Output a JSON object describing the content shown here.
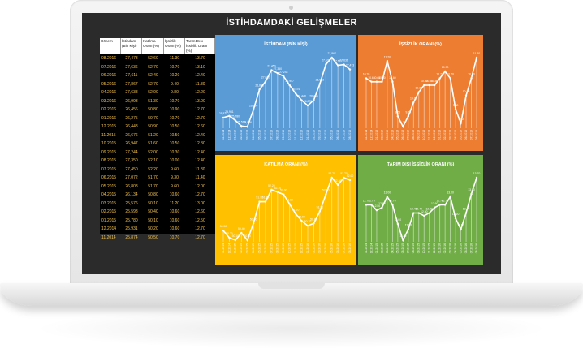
{
  "dashboard": {
    "title": "İSTİHDAMDAKİ GELİŞMELER",
    "table": {
      "headers": [
        "Dönem",
        "İstihdam (Bin Kişi)",
        "Katılma Oranı (%)",
        "İşsizlik Oranı (%)",
        "Tarım Dışı İşsizlik Oranı (%)"
      ],
      "rows": [
        [
          "08.2016",
          "27,473",
          "52.60",
          "11.30",
          "13.70"
        ],
        [
          "07.2016",
          "27,636",
          "52.70",
          "10.70",
          "13.10"
        ],
        [
          "06.2016",
          "27,611",
          "52.40",
          "10.20",
          "12.40"
        ],
        [
          "05.2016",
          "27,867",
          "52.70",
          "9.40",
          "11.80"
        ],
        [
          "04.2016",
          "27,638",
          "52.00",
          "9.80",
          "12.20"
        ],
        [
          "03.2016",
          "26,993",
          "51.30",
          "10.70",
          "13.00"
        ],
        [
          "02.2016",
          "26,456",
          "50.80",
          "10.90",
          "12.70"
        ],
        [
          "01.2016",
          "26,275",
          "50.70",
          "10.70",
          "12.70"
        ],
        [
          "12.2015",
          "26,448",
          "50.90",
          "10.50",
          "12.60"
        ],
        [
          "11.2015",
          "26,676",
          "51.20",
          "10.50",
          "12.40"
        ],
        [
          "10.2015",
          "26,947",
          "51.60",
          "10.50",
          "12.30"
        ],
        [
          "09.2015",
          "27,244",
          "52.00",
          "10.30",
          "12.40"
        ],
        [
          "08.2015",
          "27,350",
          "52.10",
          "10.00",
          "12.40"
        ],
        [
          "07.2015",
          "27,450",
          "52.20",
          "9.60",
          "11.80"
        ],
        [
          "06.2015",
          "27,072",
          "51.70",
          "9.30",
          "11.40"
        ],
        [
          "05.2015",
          "26,808",
          "51.70",
          "9.60",
          "12.00"
        ],
        [
          "04.2015",
          "26,134",
          "50.80",
          "10.60",
          "12.70"
        ],
        [
          "03.2015",
          "25,576",
          "50.10",
          "11.20",
          "13.00"
        ],
        [
          "02.2015",
          "25,593",
          "50.40",
          "10.60",
          "12.60"
        ],
        [
          "01.2015",
          "25,780",
          "50.10",
          "10.60",
          "12.50"
        ],
        [
          "12.2014",
          "25,931",
          "50.20",
          "10.60",
          "12.70"
        ],
        [
          "11.2014",
          "25,874",
          "50.50",
          "10.70",
          "12.70"
        ]
      ]
    }
  },
  "chart_data": [
    {
      "type": "line",
      "title": "İSTİHDAM (BİN KİŞİ)",
      "color": "#4a90d9",
      "x": [
        "11.2014",
        "12.2014",
        "01.2015",
        "02.2015",
        "03.2015",
        "04.2015",
        "05.2015",
        "06.2015",
        "07.2015",
        "08.2015",
        "09.2015",
        "10.2015",
        "11.2015",
        "12.2015",
        "01.2016",
        "02.2016",
        "03.2016",
        "04.2016",
        "05.2016",
        "06.2016",
        "07.2016",
        "08.2016"
      ],
      "values": [
        25874,
        25931,
        25780,
        25593,
        25576,
        26134,
        26808,
        27072,
        27450,
        27350,
        27244,
        26947,
        26676,
        26448,
        26275,
        26456,
        26993,
        27638,
        27867,
        27611,
        27636,
        27473
      ],
      "labels": [
        "25,874",
        "25,931",
        "25,780",
        "25,593",
        "25,576",
        "26,134",
        "26,808",
        "27,072",
        "27,450",
        "27,350",
        "27,244",
        "26,947",
        "26,676",
        "26,448",
        "26,275",
        "26,456",
        "26,993",
        "27,638",
        "27,867",
        "27,611",
        "27,636",
        "27,473"
      ]
    },
    {
      "type": "line",
      "title": "İŞSİZLİK ORANI (%)",
      "color": "#ed7d31",
      "x": [
        "11.2014",
        "12.2014",
        "01.2015",
        "02.2015",
        "03.2015",
        "04.2015",
        "05.2015",
        "06.2015",
        "07.2015",
        "08.2015",
        "09.2015",
        "10.2015",
        "11.2015",
        "12.2015",
        "01.2016",
        "02.2016",
        "03.2016",
        "04.2016",
        "05.2016",
        "06.2016",
        "07.2016",
        "08.2016"
      ],
      "values": [
        10.7,
        10.6,
        10.6,
        10.6,
        11.2,
        10.6,
        9.6,
        9.3,
        9.6,
        10.0,
        10.3,
        10.5,
        10.5,
        10.5,
        10.7,
        10.9,
        10.7,
        9.8,
        9.4,
        10.2,
        10.7,
        11.3
      ],
      "labels": [
        "10.70",
        "10.60",
        "10.60",
        "10.60",
        "11.20",
        "10.60",
        "9.60",
        "9.30",
        "9.60",
        "10.00",
        "10.30",
        "10.50",
        "10.50",
        "10.50",
        "10.70",
        "10.90",
        "10.70",
        "9.80",
        "9.40",
        "10.20",
        "10.70",
        "11.30"
      ]
    },
    {
      "type": "line",
      "title": "KATILMA ORANI (%)",
      "color": "#ffc000",
      "x": [
        "11.2014",
        "12.2014",
        "01.2015",
        "02.2015",
        "03.2015",
        "04.2015",
        "05.2015",
        "06.2015",
        "07.2015",
        "08.2015",
        "09.2015",
        "10.2015",
        "11.2015",
        "12.2015",
        "01.2016",
        "02.2016",
        "03.2016",
        "04.2016",
        "05.2016",
        "06.2016",
        "07.2016",
        "08.2016"
      ],
      "values": [
        50.5,
        50.2,
        50.1,
        50.4,
        50.1,
        50.8,
        51.7,
        51.7,
        52.2,
        52.1,
        52.0,
        51.6,
        51.2,
        50.9,
        50.7,
        50.8,
        51.3,
        52.0,
        52.7,
        52.4,
        52.7,
        52.6
      ],
      "labels": [
        "50.50",
        "50.20",
        "50.10",
        "50.40",
        "50.10",
        "50.80",
        "51.70",
        "51.70",
        "52.20",
        "52.10",
        "52.00",
        "51.60",
        "51.20",
        "50.90",
        "50.70",
        "50.80",
        "51.30",
        "52.00",
        "52.70",
        "52.40",
        "52.70",
        "52.60"
      ]
    },
    {
      "type": "line",
      "title": "TARIM DIŞI İŞSİZLİK ORANI (%)",
      "color": "#70ad47",
      "x": [
        "11.2014",
        "12.2014",
        "01.2015",
        "02.2015",
        "03.2015",
        "04.2015",
        "05.2015",
        "06.2015",
        "07.2015",
        "08.2015",
        "09.2015",
        "10.2015",
        "11.2015",
        "12.2015",
        "01.2016",
        "02.2016",
        "03.2016",
        "04.2016",
        "05.2016",
        "06.2016",
        "07.2016",
        "08.2016"
      ],
      "values": [
        12.7,
        12.7,
        12.5,
        12.6,
        13.0,
        12.7,
        12.0,
        11.4,
        11.8,
        12.4,
        12.4,
        12.3,
        12.4,
        12.6,
        12.7,
        12.7,
        13.0,
        12.2,
        11.8,
        12.4,
        13.1,
        13.7
      ],
      "labels": [
        "12.70",
        "12.70",
        "12.50",
        "12.60",
        "13.00",
        "12.70",
        "12.00",
        "11.40",
        "11.80",
        "12.40",
        "12.40",
        "12.30",
        "12.40",
        "12.60",
        "12.70",
        "12.70",
        "13.00",
        "12.20",
        "11.80",
        "12.40",
        "13.10",
        "13.70"
      ]
    }
  ]
}
